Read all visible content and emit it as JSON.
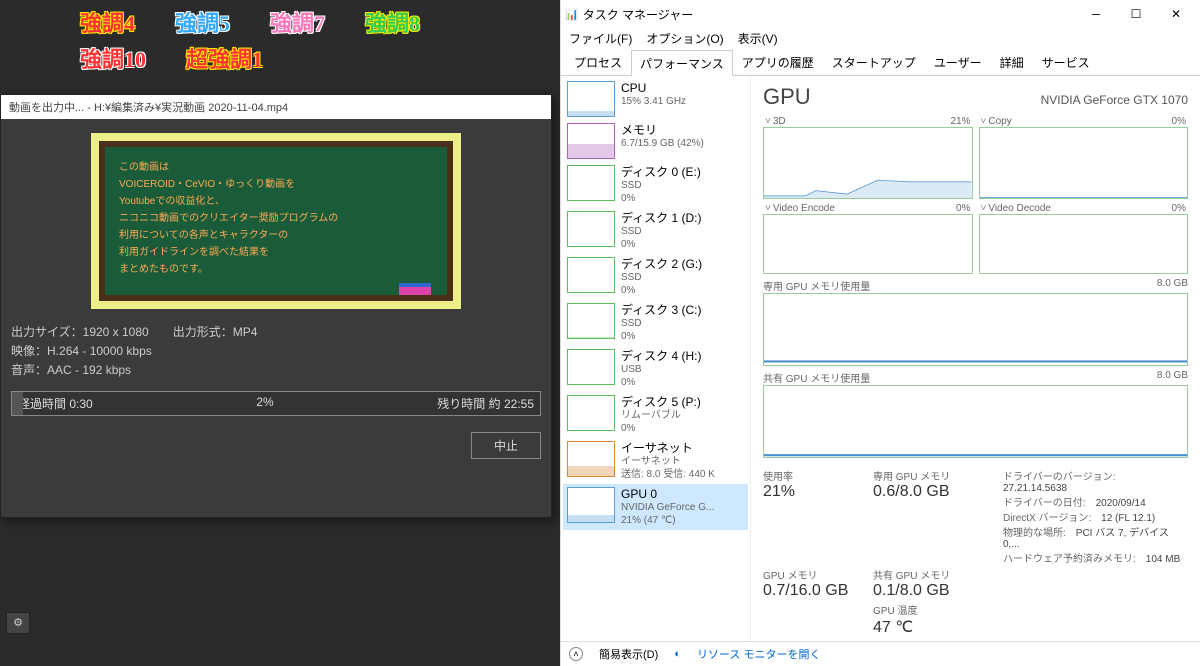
{
  "bg_editor": {
    "tags": [
      {
        "text": "強調4",
        "color": "#ff3333",
        "stroke": "#ffee00"
      },
      {
        "text": "強調5",
        "color": "#33aaff",
        "stroke": "#fff"
      },
      {
        "text": "強調7",
        "color": "#ff77bb",
        "stroke": "#fff"
      },
      {
        "text": "強調8",
        "color": "#33cc55",
        "stroke": "#ffee00"
      },
      {
        "text": "強調10",
        "color": "#ff3333",
        "stroke": "#fff"
      },
      {
        "text": "超強調1",
        "color": "#ff3333",
        "stroke": "#ffee00"
      }
    ]
  },
  "export": {
    "title": "動画を出力中... - H:¥編集済み¥実況動画 2020-11-04.mp4",
    "chalkboard": {
      "lines": [
        "この動画は",
        "VOICEROID・CeVIO・ゆっくり動画を",
        "Youtubeでの収益化と、",
        "ニコニコ動画でのクリエイター奨励プログラムの",
        "利用についての各声とキャラクターの",
        "利用ガイドラインを調べた結果を",
        "まとめたものです。"
      ]
    },
    "size_label": "出力サイズ：",
    "size_val": "1920 x 1080",
    "format_label": "出力形式：",
    "format_val": "MP4",
    "video_label": "映像：",
    "video_val": "H.264 - 10000 kbps",
    "audio_label": "音声：",
    "audio_val": "AAC - 192 kbps",
    "elapsed_label": "経過時間",
    "elapsed_val": "0:30",
    "percent": "2%",
    "remain_label": "残り時間 約",
    "remain_val": "22:55",
    "cancel": "中止"
  },
  "taskmgr": {
    "title": "タスク マネージャー",
    "menu": [
      "ファイル(F)",
      "オプション(O)",
      "表示(V)"
    ],
    "tabs": [
      "プロセス",
      "パフォーマンス",
      "アプリの履歴",
      "スタートアップ",
      "ユーザー",
      "詳細",
      "サービス"
    ],
    "active_tab": 1,
    "side": [
      {
        "name": "CPU",
        "sub1": "15%  3.41 GHz",
        "color": "#5aa0d8",
        "fill": 15
      },
      {
        "name": "メモリ",
        "sub1": "6.7/15.9 GB (42%)",
        "color": "#b060c0",
        "fill": 42
      },
      {
        "name": "ディスク 0 (E:)",
        "sub1": "SSD",
        "sub2": "0%",
        "color": "#5bbf5b",
        "fill": 0
      },
      {
        "name": "ディスク 1 (D:)",
        "sub1": "SSD",
        "sub2": "0%",
        "color": "#5bbf5b",
        "fill": 0
      },
      {
        "name": "ディスク 2 (G:)",
        "sub1": "SSD",
        "sub2": "0%",
        "color": "#5bbf5b",
        "fill": 0
      },
      {
        "name": "ディスク 3 (C:)",
        "sub1": "SSD",
        "sub2": "0%",
        "color": "#5bbf5b",
        "fill": 2
      },
      {
        "name": "ディスク 4 (H:)",
        "sub1": "USB",
        "sub2": "0%",
        "color": "#5bbf5b",
        "fill": 0
      },
      {
        "name": "ディスク 5 (P:)",
        "sub1": "リムーバブル",
        "sub2": "0%",
        "color": "#5bbf5b",
        "fill": 0
      },
      {
        "name": "イーサネット",
        "sub1": "イーサネット",
        "sub2": "送信: 8.0  受信: 440 K",
        "color": "#d88a3a",
        "fill": 30
      },
      {
        "name": "GPU 0",
        "sub1": "NVIDIA GeForce G...",
        "sub2": "21%  (47 ℃)",
        "color": "#5aa0d8",
        "fill": 21
      }
    ],
    "gpu": {
      "title": "GPU",
      "name": "NVIDIA GeForce GTX 1070",
      "graphs": {
        "g3d": {
          "label": "3D",
          "val": "21%"
        },
        "copy": {
          "label": "Copy",
          "val": "0%"
        },
        "venc": {
          "label": "Video Encode",
          "val": "0%"
        },
        "vdec": {
          "label": "Video Decode",
          "val": "0%"
        },
        "dedmem": {
          "label": "専用 GPU メモリ使用量",
          "max": "8.0 GB"
        },
        "shmem": {
          "label": "共有 GPU メモリ使用量",
          "max": "8.0 GB"
        }
      },
      "stats": {
        "usage_l": "使用率",
        "usage_v": "21%",
        "dedmem_l": "専用 GPU メモリ",
        "dedmem_v": "0.6/8.0 GB",
        "gpumem_l": "GPU メモリ",
        "gpumem_v": "0.7/16.0 GB",
        "shmem_l": "共有 GPU メモリ",
        "shmem_v": "0.1/8.0 GB",
        "temp_l": "GPU 温度",
        "temp_v": "47 ℃",
        "drv_ver_l": "ドライバーのバージョン:",
        "drv_ver_v": "27.21.14.5638",
        "drv_date_l": "ドライバーの日付:",
        "drv_date_v": "2020/09/14",
        "dx_l": "DirectX バージョン:",
        "dx_v": "12 (FL 12.1)",
        "loc_l": "物理的な場所:",
        "loc_v": "PCI バス 7, デバイス 0,...",
        "hwmem_l": "ハードウェア予約済みメモリ:",
        "hwmem_v": "104 MB"
      }
    },
    "footer": {
      "brief": "簡易表示(D)",
      "resmon": "リソース モニターを開く"
    }
  }
}
